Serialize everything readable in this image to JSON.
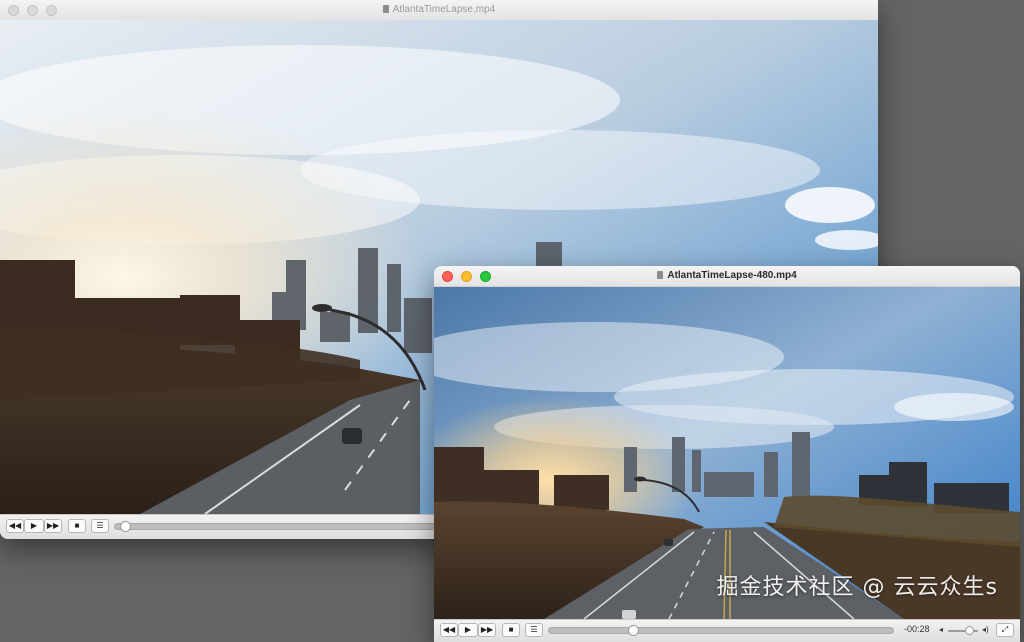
{
  "background_color": "#646464",
  "windows": [
    {
      "title": "AtlantaTimeLapse.mp4",
      "active": false,
      "progress": 0.03,
      "controls": {
        "rewind_icon": "rewind-icon",
        "play_icon": "play-icon",
        "fast_forward_icon": "fast-forward-icon",
        "stop_icon": "stop-icon",
        "playlist_icon": "playlist-icon"
      }
    },
    {
      "title": "AtlantaTimeLapse-480.mp4",
      "active": true,
      "progress": 0.245,
      "volume": 0.7,
      "time_remaining": "-00:28",
      "controls": {
        "rewind_icon": "rewind-icon",
        "play_icon": "play-icon",
        "fast_forward_icon": "fast-forward-icon",
        "stop_icon": "stop-icon",
        "playlist_icon": "playlist-icon",
        "volume_low_icon": "speaker-low-icon",
        "volume_high_icon": "speaker-high-icon",
        "fullscreen_icon": "fullscreen-icon"
      }
    }
  ],
  "traffic_light_colors": {
    "close": "#ff5f57",
    "minimize": "#febc2e",
    "zoom": "#28c840"
  },
  "watermark": "掘金技术社区 @ 云云众生s"
}
